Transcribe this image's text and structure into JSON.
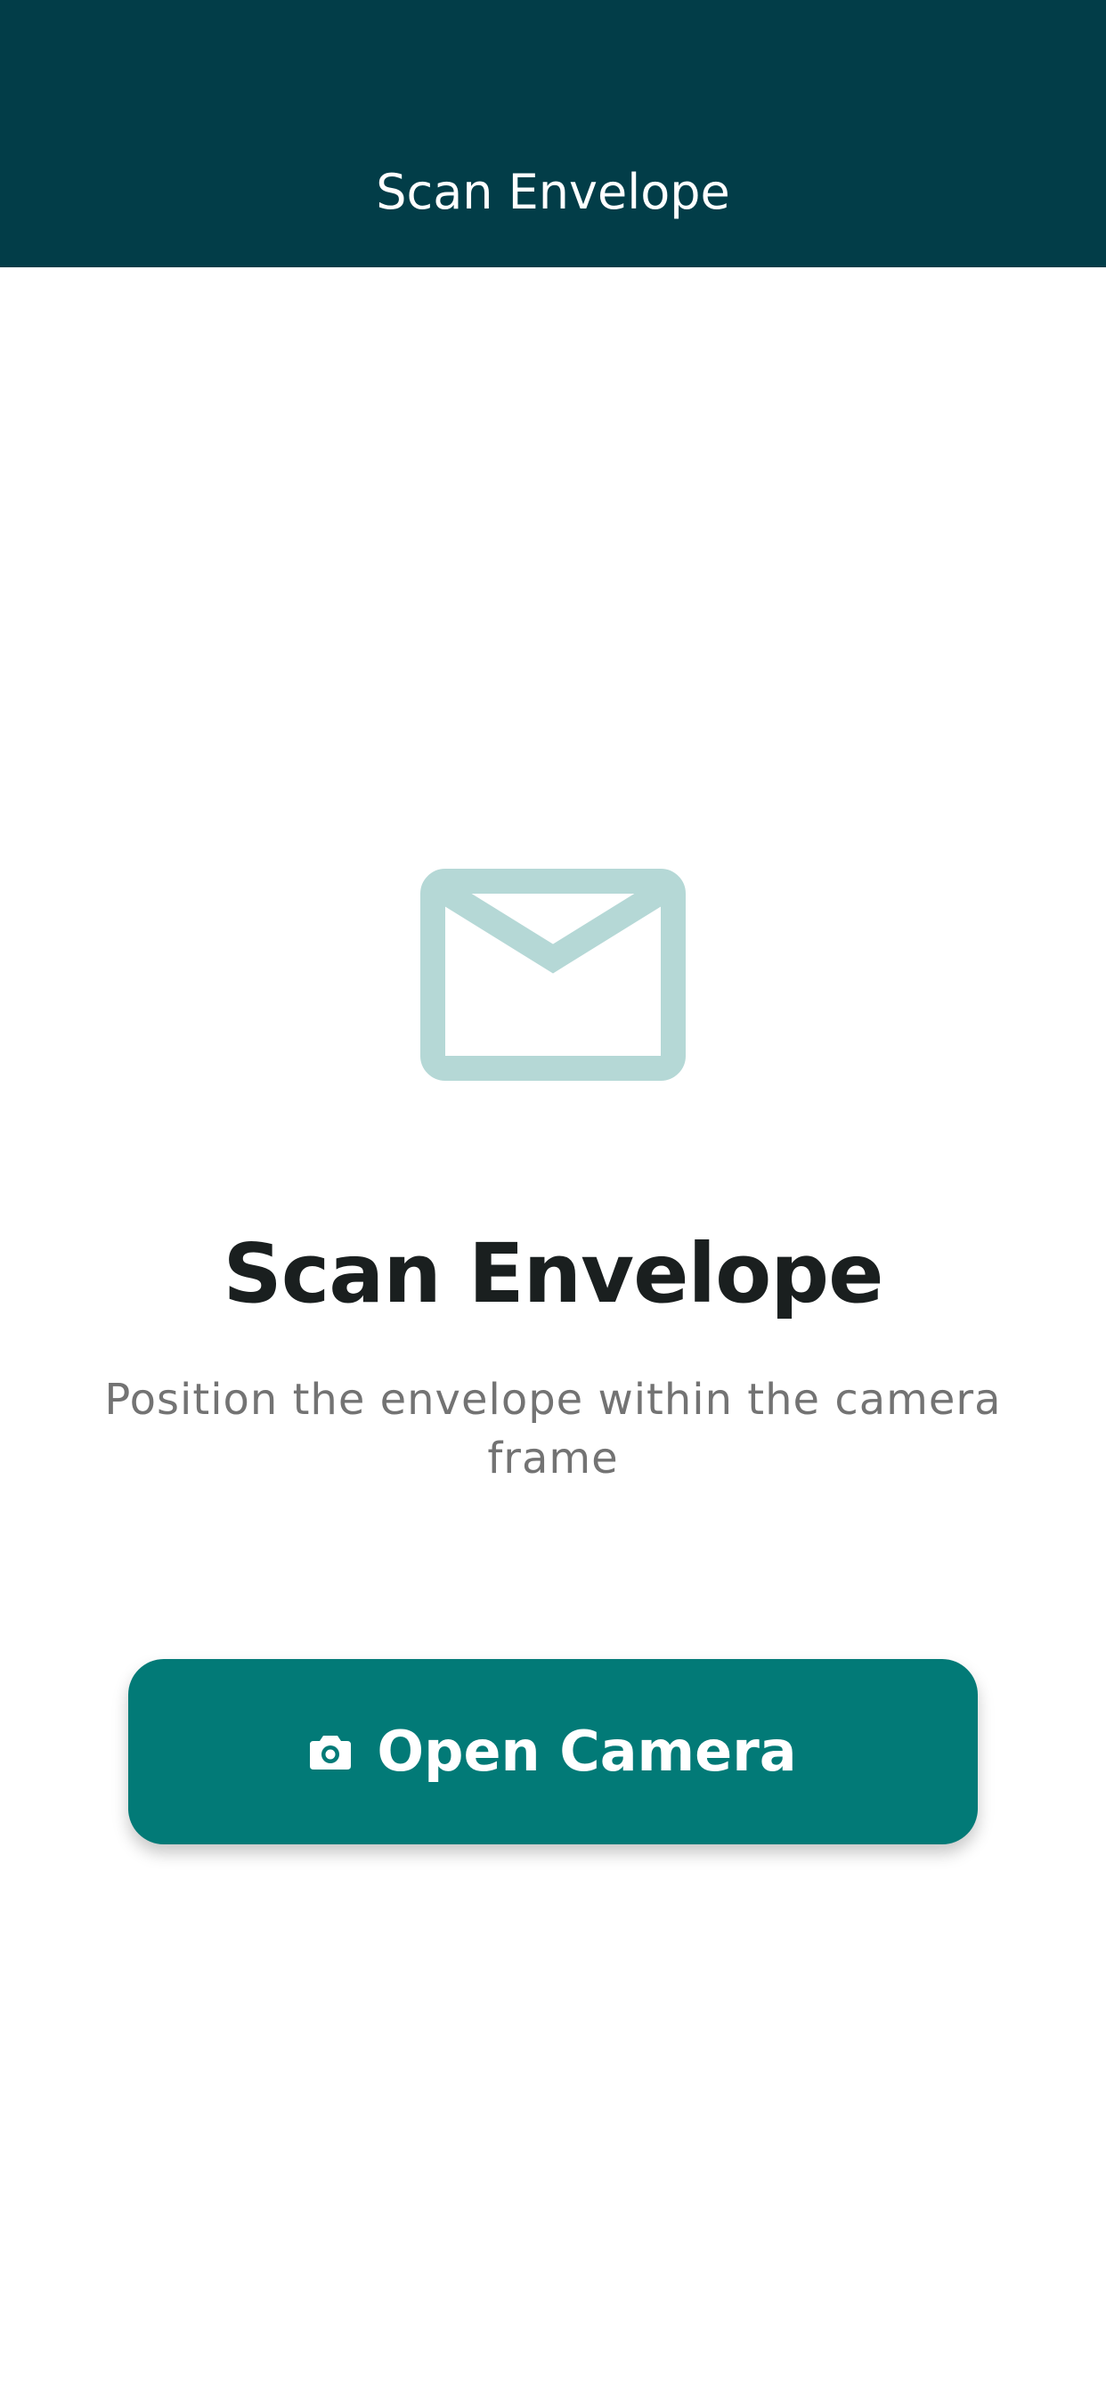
{
  "app_bar": {
    "title": "Scan Envelope"
  },
  "main": {
    "icon": "envelope-icon",
    "heading": "Scan Envelope",
    "subtitle": "Position the envelope within the camera frame",
    "button": {
      "icon": "camera-icon",
      "label": "Open Camera"
    }
  },
  "colors": {
    "app_bar_background": "#023d48",
    "button_background": "#027a77",
    "icon_tint": "#b5d8d6",
    "heading_text": "#1a1f1f",
    "subtitle_text": "#737373",
    "page_background": "#ffffff"
  }
}
